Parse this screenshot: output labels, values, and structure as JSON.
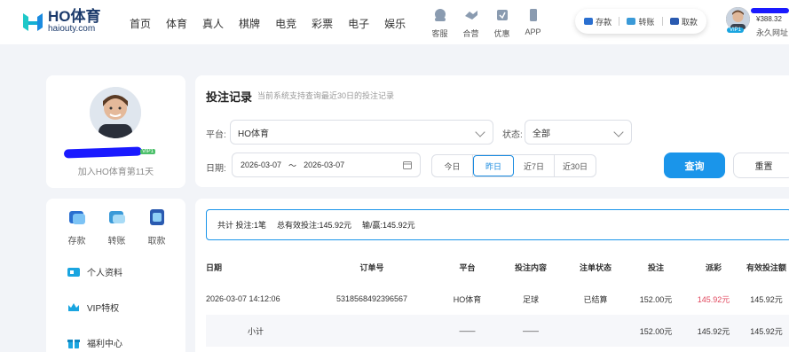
{
  "header": {
    "brand": "HO体育",
    "domain": "haiouty.com",
    "nav": [
      "首页",
      "体育",
      "真人",
      "棋牌",
      "电竞",
      "彩票",
      "电子",
      "娱乐"
    ],
    "tools": [
      {
        "label": "客服",
        "icon": "customer-service-icon"
      },
      {
        "label": "合营",
        "icon": "partnership-icon"
      },
      {
        "label": "优惠",
        "icon": "promotion-icon"
      },
      {
        "label": "APP",
        "icon": "phone-icon"
      }
    ],
    "quick": [
      {
        "label": "存款",
        "icon": "deposit-icon"
      },
      {
        "label": "转账",
        "icon": "transfer-icon"
      },
      {
        "label": "取款",
        "icon": "withdraw-icon"
      }
    ],
    "user": {
      "balance": "¥388.32",
      "vip": "VIP1",
      "permanent": "永久网址"
    }
  },
  "sidebar": {
    "join_text": "加入HO体育第11天",
    "vip_tag": "VIP1",
    "funds": [
      {
        "label": "存款",
        "icon": "deposit-icon"
      },
      {
        "label": "转账",
        "icon": "transfer-icon"
      },
      {
        "label": "取款",
        "icon": "withdraw-icon"
      }
    ],
    "menu": [
      {
        "label": "个人资料",
        "icon": "profile-card-icon"
      },
      {
        "label": "VIP特权",
        "icon": "crown-icon"
      },
      {
        "label": "福利中心",
        "icon": "gift-icon"
      }
    ]
  },
  "filter": {
    "title": "投注记录",
    "subtitle": "当前系统支持查询最近30日的投注记录",
    "platform_label": "平台:",
    "platform_value": "HO体育",
    "status_label": "状态:",
    "status_value": "全部",
    "date_label": "日期:",
    "date_start": "2026-03-07",
    "date_sep": "～",
    "date_end": "2026-03-07",
    "quick_dates": [
      "今日",
      "昨日",
      "近7日",
      "近30日"
    ],
    "active_quick": "昨日",
    "query": "查询",
    "reset": "重置"
  },
  "summary": {
    "count": "共计 投注:1笔",
    "valid": "总有效投注:145.92元",
    "winloss": "输/赢:145.92元"
  },
  "table": {
    "headers": [
      "日期",
      "订单号",
      "平台",
      "投注内容",
      "注单状态",
      "投注",
      "派彩",
      "有效投注额"
    ],
    "rows": [
      [
        "2026-03-07 14:12:06",
        "5318568492396567",
        "HO体育",
        "足球",
        "已结算",
        "152.00元",
        "145.92元",
        "145.92元"
      ]
    ],
    "subtotal": [
      "小计",
      "",
      "——",
      "——",
      "",
      "152.00元",
      "145.92元",
      "145.92元"
    ]
  },
  "colors": {
    "accent": "#1a95ea",
    "payout": "#e0465c",
    "redaction": "#1a1aff"
  }
}
